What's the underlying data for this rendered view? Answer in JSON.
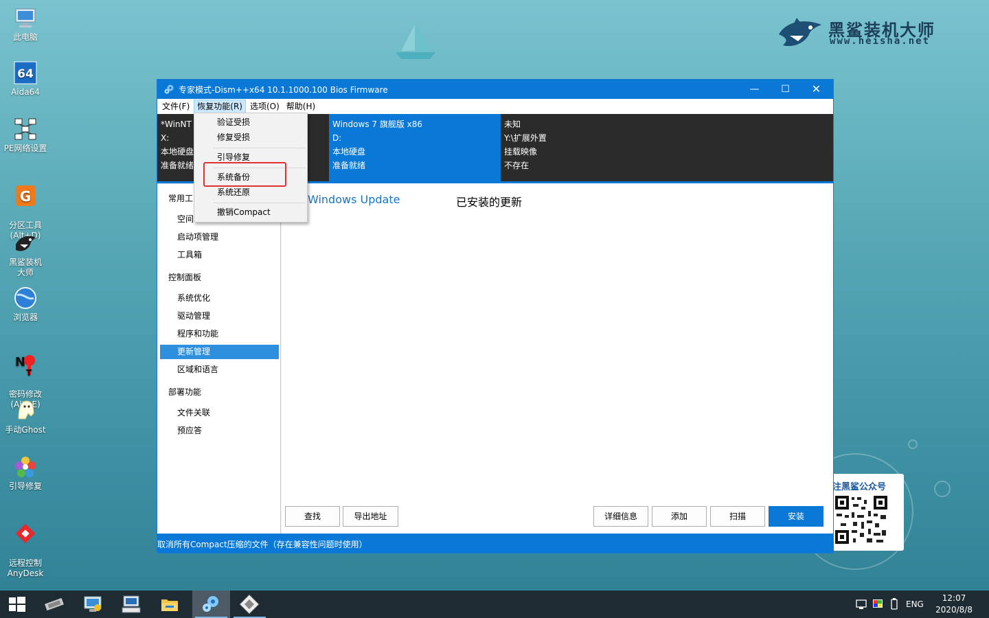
{
  "desktop": {
    "brand": {
      "name": "黑鲨装机大师",
      "url": "www.heisha.net"
    },
    "icons": [
      {
        "label": "此电脑",
        "icon": "computer-icon"
      },
      {
        "label": "Aida64",
        "icon": "aida64-icon"
      },
      {
        "label": "PE网络设置",
        "icon": "network-icon"
      },
      {
        "label": "分区工具\n(Alt+D)",
        "icon": "partition-icon"
      },
      {
        "label": "黑鲨装机大师",
        "icon": "shark-icon"
      },
      {
        "label": "浏览器",
        "icon": "browser-icon"
      },
      {
        "label": "密码修改\n(Alt+E)",
        "icon": "password-icon"
      },
      {
        "label": "手动Ghost",
        "icon": "ghost-icon"
      },
      {
        "label": "引导修复",
        "icon": "boot-repair-icon"
      },
      {
        "label": "远程控制\nAnyDesk",
        "icon": "anydesk-icon"
      }
    ],
    "qr": {
      "title": "注黑鲨公众号"
    }
  },
  "window": {
    "title": "专家模式-Dism++x64 10.1.1000.100 Bios Firmware",
    "menu": [
      "文件(F)",
      "恢复功能(R)",
      "选项(O)",
      "帮助(H)"
    ],
    "active_menu_index": 1,
    "info_columns": [
      {
        "lines": [
          "*WinNT",
          "X:",
          "本地硬盘",
          "准备就绪"
        ]
      },
      {
        "lines": [
          "Windows 7 旗舰版 x86",
          "D:",
          "本地硬盘",
          "准备就绪"
        ]
      },
      {
        "lines": [
          "未知",
          "Y:\\扩展外置",
          "挂载映像",
          "不存在"
        ]
      }
    ],
    "dropdown": {
      "items": [
        "验证受损",
        "修复受损",
        "引导修复",
        "系统备份",
        "系统还原",
        "撤销Compact"
      ],
      "highlighted_item": "系统备份"
    },
    "nav": {
      "groups": [
        {
          "label": "常用工",
          "items": [
            "空间",
            "启动项管理",
            "工具箱"
          ]
        },
        {
          "label": "控制面板",
          "items": [
            "系统优化",
            "驱动管理",
            "程序和功能",
            "更新管理",
            "区域和语言"
          ]
        },
        {
          "label": "部署功能",
          "items": [
            "文件关联",
            "预应答"
          ]
        }
      ],
      "selected": "更新管理"
    },
    "content": {
      "tabs": [
        "Windows Update",
        "已安装的更新"
      ],
      "left_buttons": [
        "查找",
        "导出地址"
      ],
      "right_buttons": [
        "详细信息",
        "添加",
        "扫描",
        "安装"
      ],
      "primary_button": "安装"
    },
    "status": "取消所有Compact压缩的文件（存在兼容性问题时使用）"
  },
  "taskbar": {
    "language": "ENG",
    "time": "12:07",
    "date": "2020/8/8"
  },
  "colors": {
    "accent": "#0a78d7",
    "info_bg": "#2b2b2b",
    "highlight_border": "#e03030",
    "nav_selected": "#2e8fde"
  }
}
